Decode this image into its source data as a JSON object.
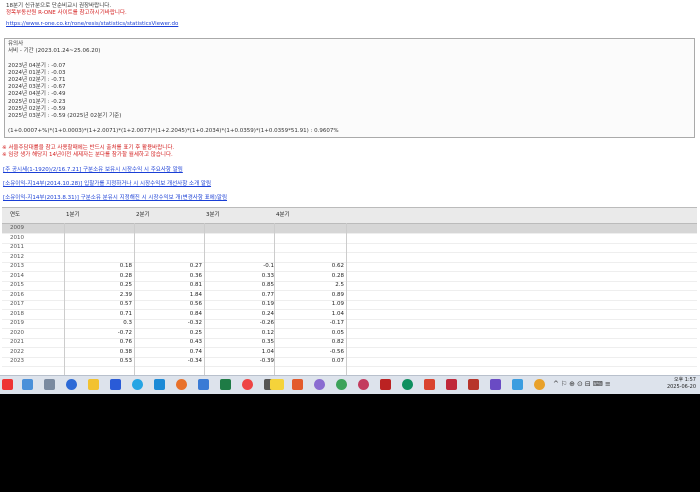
{
  "header": {
    "line1": "18분기 신규분으로 단순비교시 권장바랍니다.",
    "line2": "정목부동산원 R-ONE 사이트를 참고하시기바랍니다.",
    "url": "https://www.r-one.co.kr/rone/resis/statistics/statisticsViewer.do"
  },
  "infobox": {
    "title": "유의사",
    "period": "서비 - 기간 (2023.01.24~25.06.20)",
    "quarters": [
      "2023년 04분기 : -0.07",
      "2024년 01분기 : -0.03",
      "2024년 02분기 : -0.71",
      "2024년 03분기 : -0.67",
      "2024년 04분기 : -0.49",
      "2025년 01분기 : -0.23",
      "2025년 02분기 : -0.59",
      "2025년 03분기 : -0.59 (2025년 02분기 기준)"
    ],
    "formula": "(1+0.0007+%)*(1+0.0003)*(1+2.0071)*(1+2.0077)*(1+2.2045)*(1+0.2034)*(1+0.0359)*(1+0.0359*51.91) : 0.9607%"
  },
  "warnings": [
    "※ 서울주담대률을 참고 사용할때에는 반드시 출처를 표기 후 활용바랍니다.",
    "※ 임광 생가 해당지 14년이전 세제자는 분다를 참가할 월세하고 않습니다."
  ],
  "links": [
    "[주 공시세(1-1920)/2/16.7.21] 구분소유 보유시 시장수익 시 주요사항 알림",
    "[소유이익-지14부(2014.10.28)] 입찰가를 지정하거나 시 시장수익보 개선사항 소개 알림",
    "[소유이익-지14부(2013.8.31)] 구분소유 분유시 지정해진 시 시장수익보 개(변경사항 표에)알림"
  ],
  "grid": {
    "headers": [
      "연도",
      "1분기",
      "2분기",
      "3분기",
      "4분기"
    ],
    "rows": [
      {
        "year": "2009",
        "v": [
          "",
          "",
          "",
          ""
        ]
      },
      {
        "year": "2010",
        "v": [
          "",
          "",
          "",
          ""
        ]
      },
      {
        "year": "2011",
        "v": [
          "",
          "",
          "",
          ""
        ]
      },
      {
        "year": "2012",
        "v": [
          "",
          "",
          "",
          ""
        ]
      },
      {
        "year": "2013",
        "v": [
          "0.18",
          "0.27",
          "-0.1",
          "0.62"
        ]
      },
      {
        "year": "2014",
        "v": [
          "0.28",
          "0.36",
          "0.33",
          "0.28"
        ]
      },
      {
        "year": "2015",
        "v": [
          "0.25",
          "0.81",
          "0.85",
          "2.5"
        ]
      },
      {
        "year": "2016",
        "v": [
          "2.39",
          "1.84",
          "0.77",
          "0.89"
        ]
      },
      {
        "year": "2017",
        "v": [
          "0.57",
          "0.56",
          "0.19",
          "1.09"
        ]
      },
      {
        "year": "2018",
        "v": [
          "0.71",
          "0.84",
          "0.24",
          "1.04"
        ]
      },
      {
        "year": "2019",
        "v": [
          "0.3",
          "-0.32",
          "-0.26",
          "-0.17"
        ]
      },
      {
        "year": "2020",
        "v": [
          "-0.72",
          "0.25",
          "0.12",
          "0.05"
        ]
      },
      {
        "year": "2021",
        "v": [
          "0.76",
          "0.43",
          "0.35",
          "0.82"
        ]
      },
      {
        "year": "2022",
        "v": [
          "0.38",
          "0.74",
          "1.04",
          "-0.56"
        ]
      },
      {
        "year": "2023",
        "v": [
          "0.53",
          "-0.34",
          "-0.39",
          "0.07"
        ]
      }
    ]
  },
  "tray": {
    "time": "오후 1:57",
    "date": "2025-06-20"
  }
}
